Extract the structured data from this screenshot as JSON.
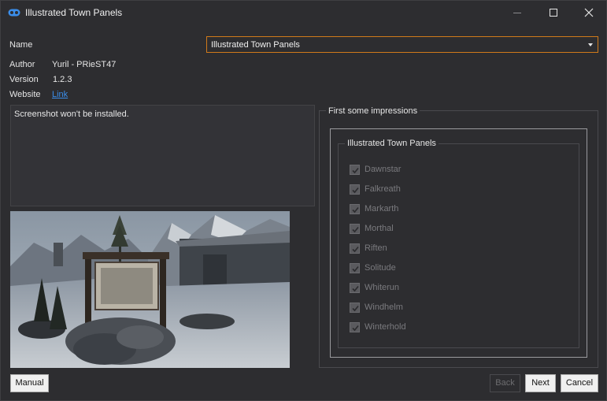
{
  "window": {
    "title": "Illustrated Town Panels",
    "icon": "link-chain-icon",
    "controls": [
      "minimize-icon",
      "maximize-icon",
      "close-icon"
    ]
  },
  "info": {
    "name_label": "Name",
    "name_value": "Illustrated Town Panels",
    "author_label": "Author",
    "author_value": "Yuril - PRieST47",
    "version_label": "Version",
    "version_value": "1.2.3",
    "website_label": "Website",
    "website_link": "Link"
  },
  "description": "Screenshot won't be installed.",
  "options": {
    "group_title": "First some impressions",
    "subgroup_title": "Illustrated Town Panels",
    "items": [
      {
        "label": "Dawnstar",
        "checked": true
      },
      {
        "label": "Falkreath",
        "checked": true
      },
      {
        "label": "Markarth",
        "checked": true
      },
      {
        "label": "Morthal",
        "checked": true
      },
      {
        "label": "Riften",
        "checked": true
      },
      {
        "label": "Solitude",
        "checked": true
      },
      {
        "label": "Whiterun",
        "checked": true
      },
      {
        "label": "Windhelm",
        "checked": true
      },
      {
        "label": "Winterhold",
        "checked": true
      }
    ]
  },
  "buttons": {
    "manual": "Manual",
    "back": "Back",
    "next": "Next",
    "cancel": "Cancel"
  },
  "colors": {
    "background": "#2d2d30",
    "accent_border": "#d07a1a",
    "link": "#3b8eea"
  }
}
